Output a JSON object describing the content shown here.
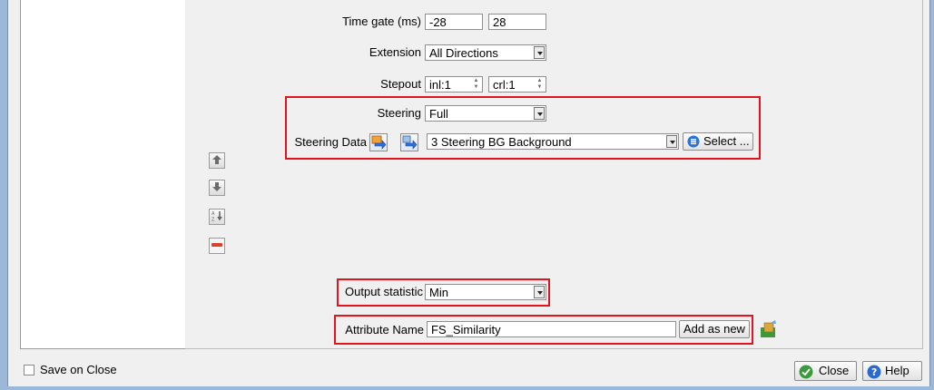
{
  "form": {
    "time_gate": {
      "label": "Time gate (ms)",
      "start": "-28",
      "stop": "28"
    },
    "extension": {
      "label": "Extension",
      "value": "All Directions"
    },
    "stepout": {
      "label": "Stepout",
      "inline": "inl:1",
      "crossline": "crl:1"
    },
    "steering": {
      "label": "Steering",
      "value": "Full"
    },
    "steering_data": {
      "label": "Steering Data",
      "value": "3 Steering BG Background",
      "select_label": "Select ..."
    },
    "output_statistic": {
      "label": "Output statistic",
      "value": "Min"
    },
    "attribute_name": {
      "label": "Attribute Name",
      "value": "FS_Similarity",
      "add_label": "Add as new"
    }
  },
  "side_toolbar": {
    "icons": [
      "move-up-icon",
      "move-down-icon",
      "sort-az-icon",
      "remove-icon"
    ]
  },
  "footer": {
    "save_on_close": "Save on Close",
    "close_label": "Close",
    "help_label": "Help"
  },
  "colors": {
    "highlight": "#e3141c",
    "frame": "#9bb8d8"
  }
}
